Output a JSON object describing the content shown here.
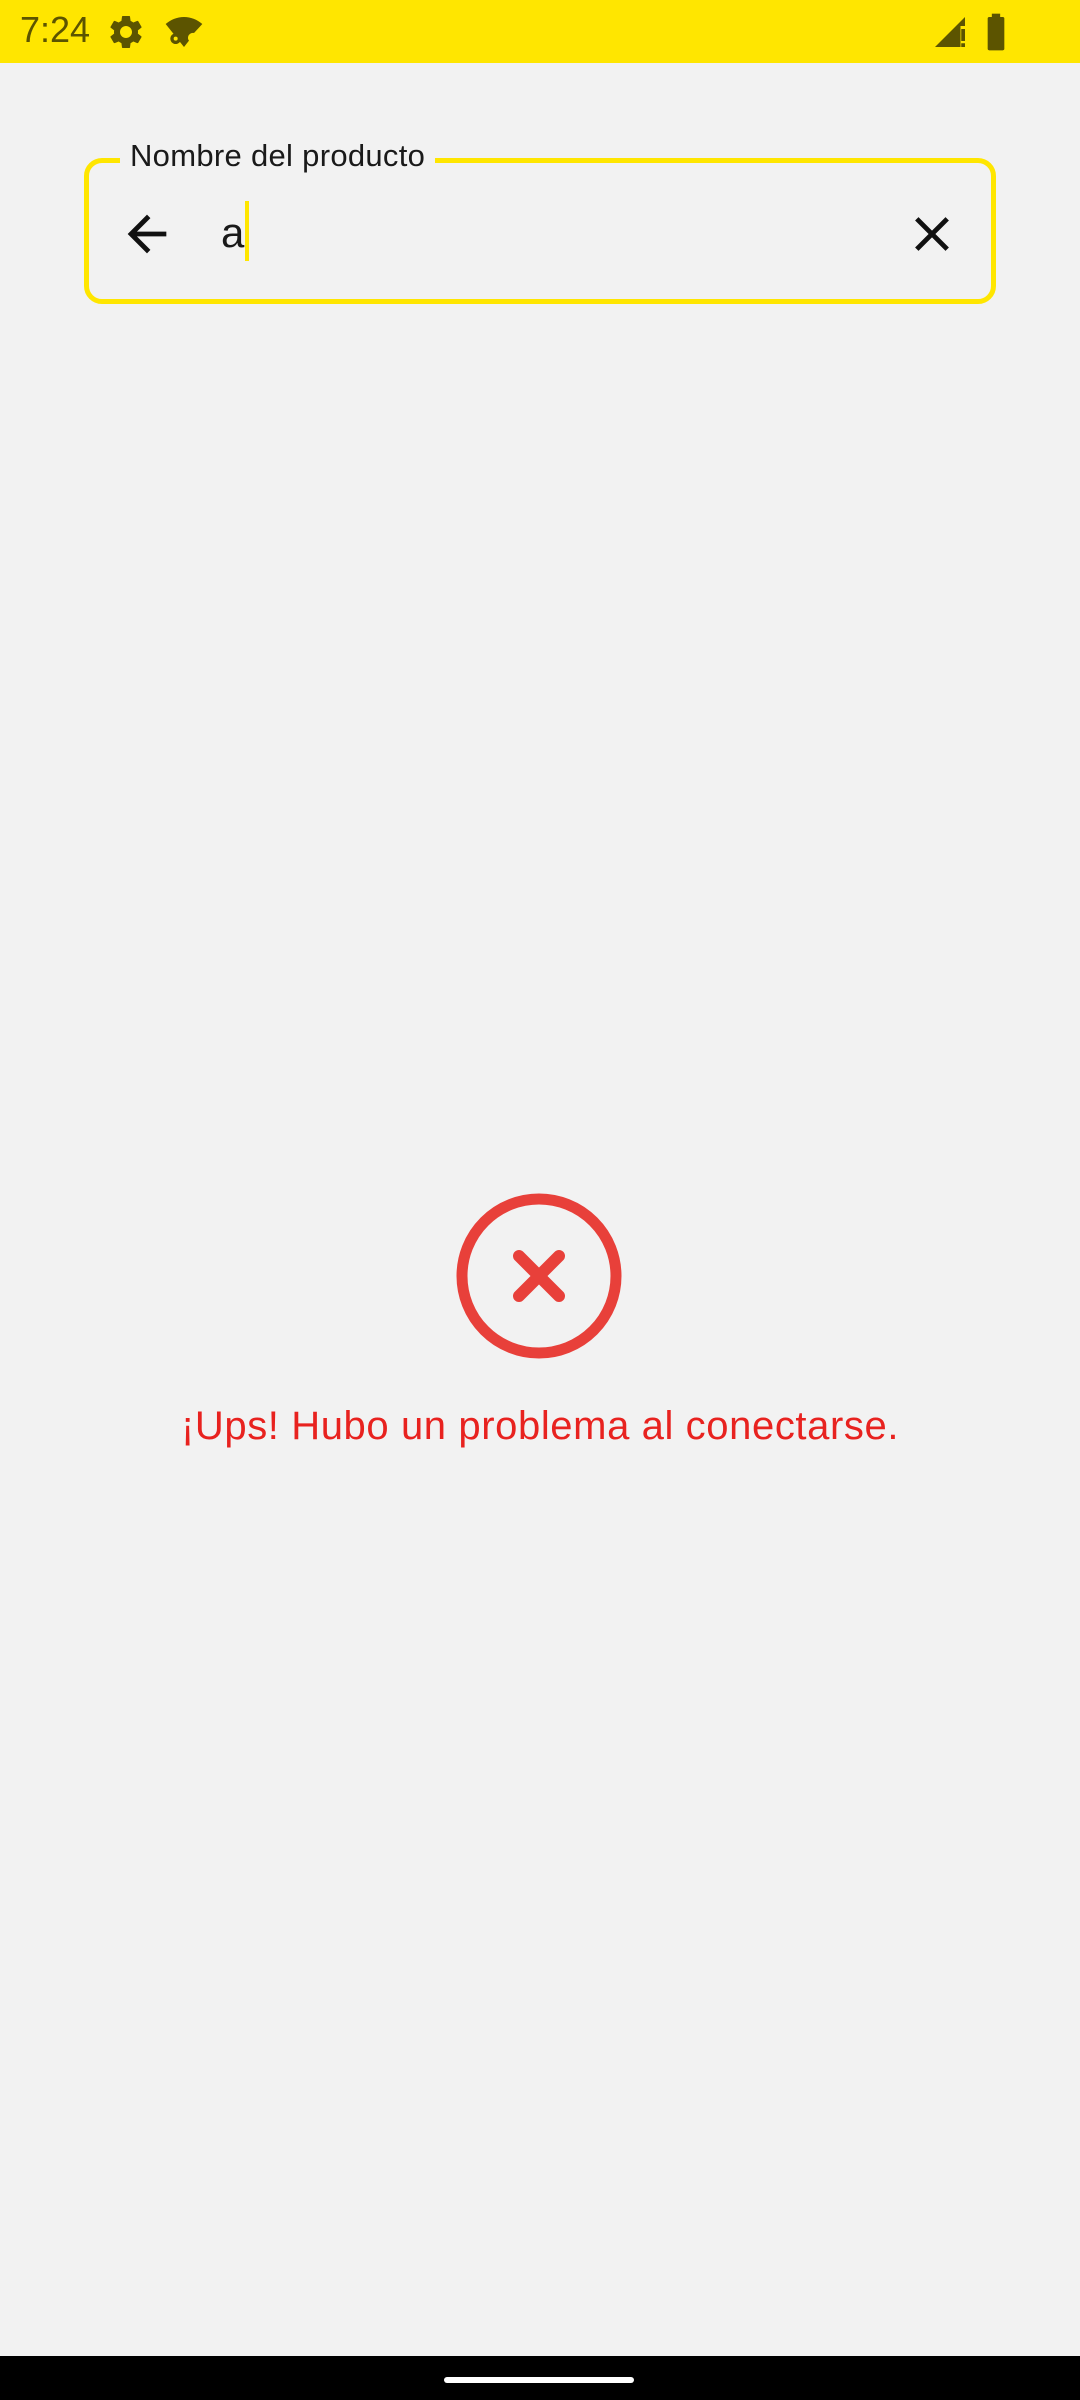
{
  "status_bar": {
    "time": "7:24",
    "icons": [
      "gear-icon",
      "wifi-settings-icon",
      "signal-icon",
      "battery-icon"
    ],
    "background_color": "#ffe600"
  },
  "search": {
    "label": "Nombre del producto",
    "value": "a",
    "accent_color": "#ffe600"
  },
  "error": {
    "icon": "error-circle-x-icon",
    "message": "¡Ups! Hubo un problema al conectarse.",
    "color": "#e8221f"
  },
  "nav_bar": {
    "handle": "home-handle"
  }
}
